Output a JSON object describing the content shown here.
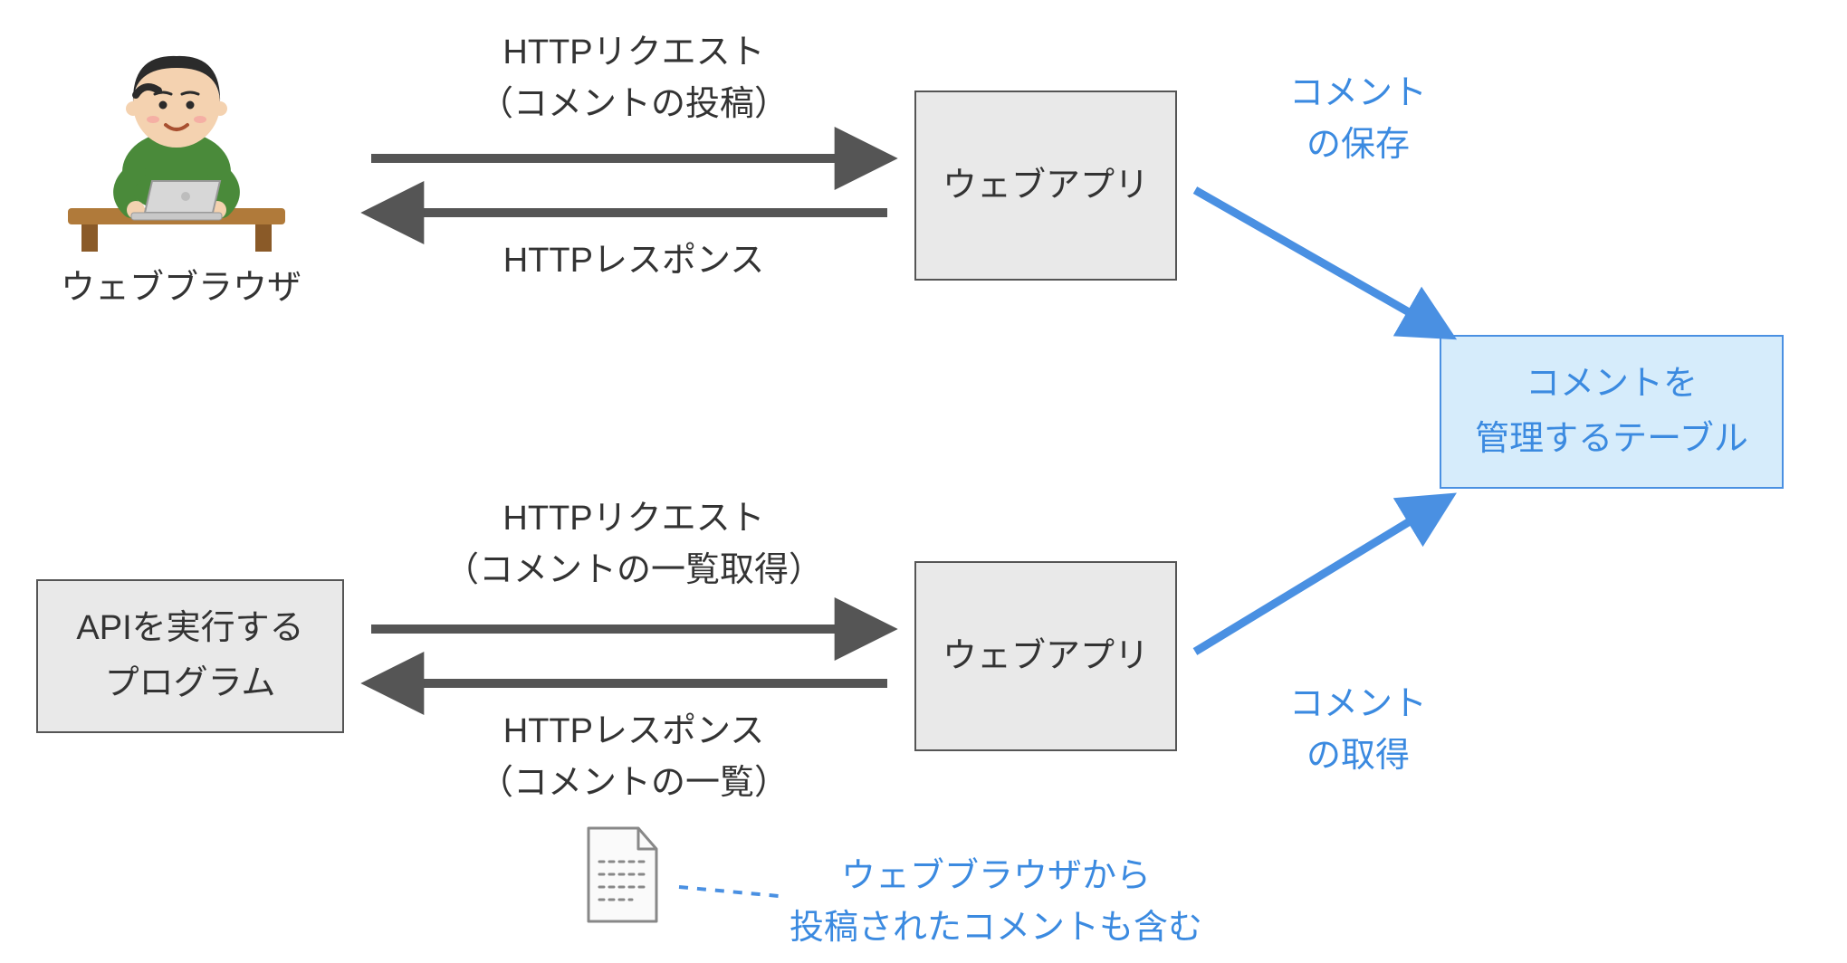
{
  "actors": {
    "browser_label": "ウェブブラウザ",
    "api_client_line1": "APIを実行する",
    "api_client_line2": "プログラム"
  },
  "webapp": {
    "label": "ウェブアプリ"
  },
  "db": {
    "line1": "コメントを",
    "line2": "管理するテーブル"
  },
  "flow_top": {
    "request_line1": "HTTPリクエスト",
    "request_line2": "（コメントの投稿）",
    "response": "HTTPレスポンス"
  },
  "flow_bottom": {
    "request_line1": "HTTPリクエスト",
    "request_line2": "（コメントの一覧取得）",
    "response_line1": "HTTPレスポンス",
    "response_line2": "（コメントの一覧）"
  },
  "db_ops": {
    "save_line1": "コメント",
    "save_line2": "の保存",
    "fetch_line1": "コメント",
    "fetch_line2": "の取得"
  },
  "note": {
    "line1": "ウェブブラウザから",
    "line2": "投稿されたコメントも含む"
  }
}
